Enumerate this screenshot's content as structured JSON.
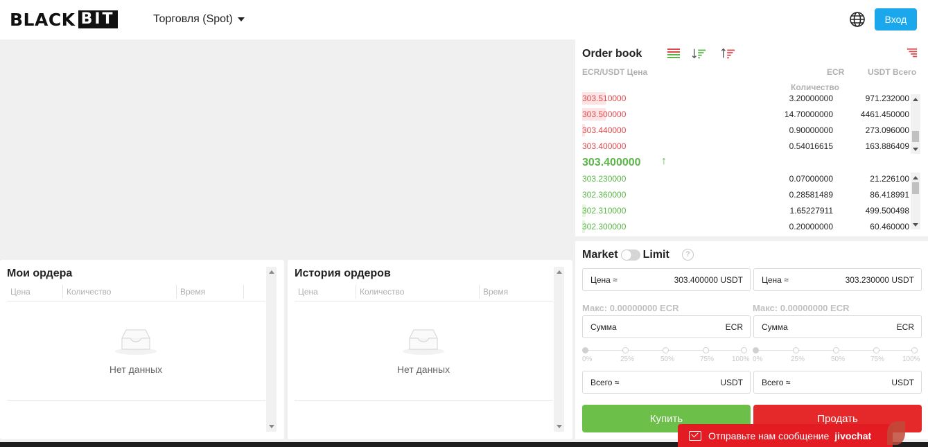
{
  "header": {
    "logo_main": "BLACK",
    "logo_box": "BIT",
    "mode_label": "Торговля (Spot)",
    "login_label": "Вход"
  },
  "my_orders": {
    "title": "Мои ордера",
    "columns": [
      "Цена",
      "Количество",
      "Время"
    ],
    "empty_text": "Нет данных"
  },
  "order_history": {
    "title": "История ордеров",
    "columns": [
      "Цена",
      "Количество",
      "Время"
    ],
    "empty_text": "Нет данных"
  },
  "orderbook": {
    "title": "Order book",
    "col_price": "ECR/USDT Цена",
    "col_amount_1": "ECR",
    "col_amount_2": "Количество",
    "col_total": "USDT Всего",
    "asks": [
      {
        "price": "303.510000",
        "amount": "3.20000000",
        "total": "971.232000",
        "depth": 0.07
      },
      {
        "price": "303.500000",
        "amount": "14.70000000",
        "total": "4461.450000",
        "depth": 0.07
      },
      {
        "price": "303.440000",
        "amount": "0.90000000",
        "total": "273.096000",
        "depth": 0.01
      },
      {
        "price": "303.400000",
        "amount": "0.54016615",
        "total": "163.886409",
        "depth": 0.0
      }
    ],
    "last_price": "303.400000",
    "last_arrow": "↑",
    "bids": [
      {
        "price": "303.230000",
        "amount": "0.07000000",
        "total": "21.226100",
        "depth": 0.0
      },
      {
        "price": "302.360000",
        "amount": "0.28581489",
        "total": "86.418991",
        "depth": 0.0
      },
      {
        "price": "302.310000",
        "amount": "1.65227911",
        "total": "499.500498",
        "depth": 0.01
      },
      {
        "price": "302.300000",
        "amount": "0.20000000",
        "total": "60.460000",
        "depth": 0.01
      }
    ],
    "colors": {
      "ask": "#e0474a",
      "bid": "#5ab548",
      "ask_bg": "#fde4e4",
      "bid_bg": "#e3f5dd"
    }
  },
  "trade": {
    "tab_market": "Market",
    "tab_limit": "Limit",
    "help": "?",
    "buy": {
      "price_label": "Цена ≈",
      "price_value": "303.400000",
      "price_unit": "USDT",
      "max_label": "Макс: 0.00000000 ECR",
      "amount_label": "Сумма",
      "amount_unit": "ECR",
      "total_label": "Всего ≈",
      "total_unit": "USDT",
      "button": "Купить"
    },
    "sell": {
      "price_label": "Цена ≈",
      "price_value": "303.230000",
      "price_unit": "USDT",
      "max_label": "Макс: 0.00000000 ECR",
      "amount_label": "Сумма",
      "amount_unit": "ECR",
      "total_label": "Всего ≈",
      "total_unit": "USDT",
      "button": "Продать"
    },
    "percent_marks": [
      "0%",
      "25%",
      "50%",
      "75%",
      "100%"
    ],
    "colors": {
      "buy": "#6cc04a",
      "sell": "#e5292b"
    }
  },
  "jivochat": {
    "message": "Отправьте нам сообщение",
    "brand": "jivochat"
  }
}
